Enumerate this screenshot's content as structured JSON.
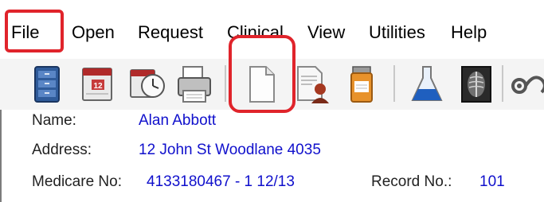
{
  "menu": {
    "file": "File",
    "open": "Open",
    "request": "Request",
    "clinical": "Clinical",
    "view": "View",
    "utilities": "Utilities",
    "help": "Help"
  },
  "toolbar": {
    "buttons": [
      "server-icon",
      "calendar-icon",
      "calendar-clock-icon",
      "printer-icon",
      "blank-document-icon",
      "document-person-icon",
      "pill-bottle-icon",
      "flask-icon",
      "xray-icon",
      "stethoscope-icon"
    ]
  },
  "patient": {
    "name_label": "Name:",
    "name_value": "Alan Abbott",
    "address_label": "Address:",
    "address_value": "12 John St  Woodlane  4035",
    "medicare_label": "Medicare No:",
    "medicare_value": "4133180467 - 1  12/13",
    "record_label": "Record No.:",
    "record_value": "101"
  },
  "colors": {
    "highlight": "#e0242b",
    "value_text": "#1010cc"
  }
}
